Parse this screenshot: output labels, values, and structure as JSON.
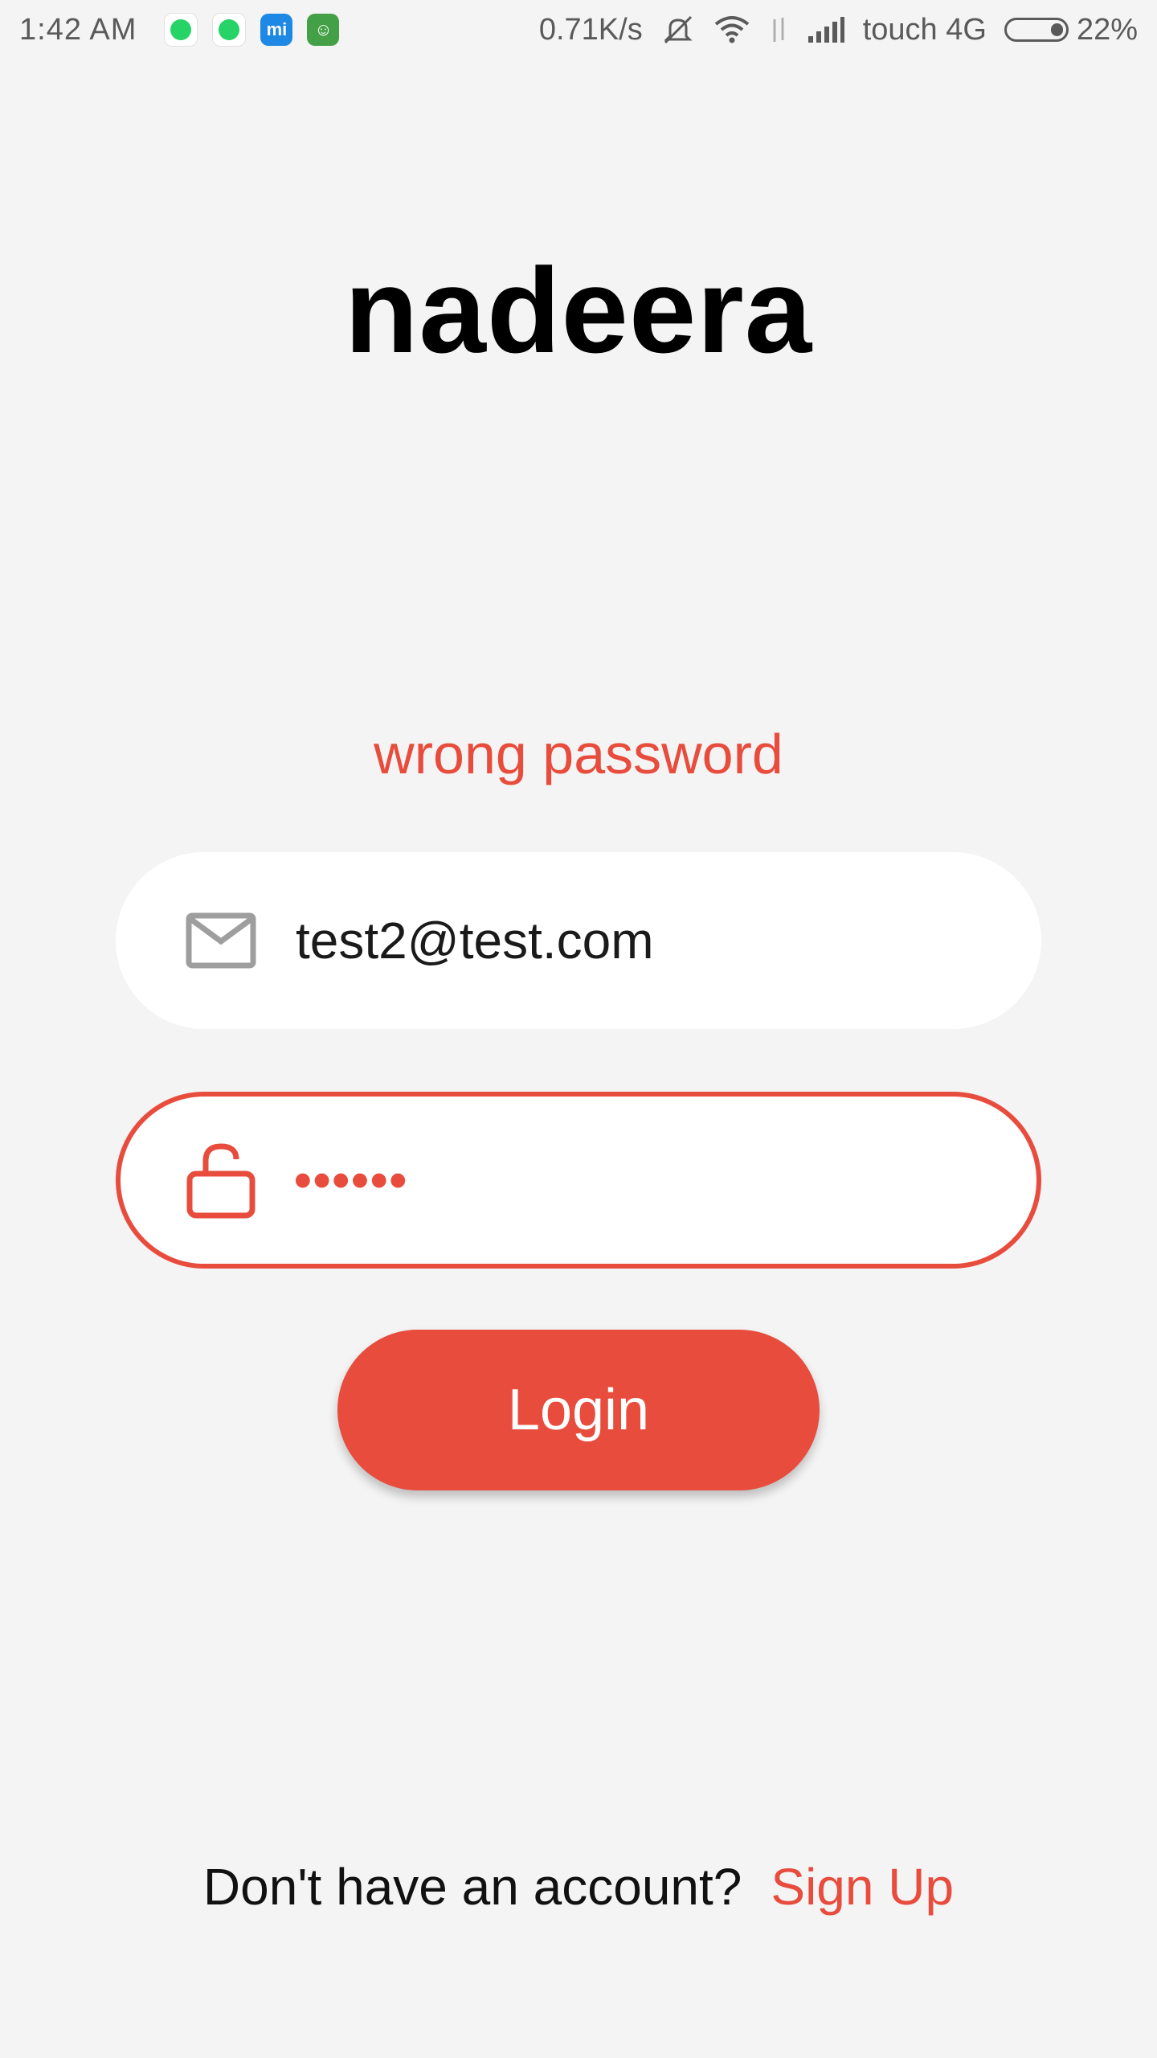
{
  "status_bar": {
    "time": "1:42 AM",
    "network_speed": "0.71K/s",
    "carrier": "touch 4G",
    "battery": "22%",
    "battery_fraction": 0.22,
    "icons": [
      "whatsapp-icon",
      "whatsapp-icon",
      "mi-icon",
      "app-icon",
      "mute-icon",
      "wifi-icon",
      "data-arrows-icon",
      "signal-icon"
    ]
  },
  "app": {
    "brand": "nadeera",
    "error_message": "wrong password"
  },
  "form": {
    "email": {
      "value": "test2@test.com",
      "icon": "mail-icon"
    },
    "password": {
      "value": "••••••",
      "icon": "unlock-icon"
    },
    "login_label": "Login"
  },
  "footer": {
    "prompt": "Don't have an account?",
    "signup_label": "Sign Up"
  },
  "colors": {
    "accent": "#e84c3d",
    "background": "#f4f4f4",
    "field_background": "#ffffff"
  }
}
